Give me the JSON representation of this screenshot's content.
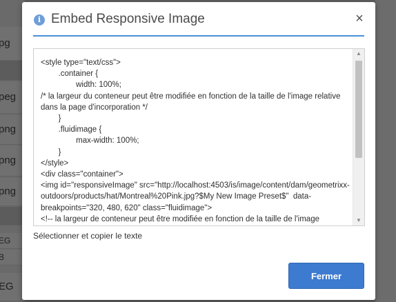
{
  "background": {
    "rows": [
      {
        "label": "pg",
        "style": "normal"
      },
      {
        "label": "",
        "style": "dark"
      },
      {
        "label": "peg",
        "style": "normal"
      },
      {
        "label": "png",
        "style": "normal"
      },
      {
        "label": "png",
        "style": "normal"
      },
      {
        "label": "png",
        "style": "normal"
      },
      {
        "label": "",
        "style": "dark"
      },
      {
        "label": "EG",
        "style": "small"
      },
      {
        "label": "B",
        "style": "small"
      },
      {
        "label": "EG",
        "style": "normal"
      }
    ]
  },
  "dialog": {
    "title": "Embed Responsive Image",
    "info_icon": "i",
    "close_icon": "×",
    "code": "<style type=\"text/css\">\n        .container {\n                width: 100%;\n/* la largeur du conteneur peut être modifiée en fonction de la taille de l'image relative dans la page d'incorporation */\n        }\n        .fluidimage {\n                max-width: 100%;\n        }\n</style>\n<div class=\"container\">\n<img id=\"responsiveImage\" src=\"http://localhost:4503/is/image/content/dam/geometrixx-outdoors/products/hat/Montreal%20Pink.jpg?$My New Image Preset$\"  data-breakpoints=\"320, 480, 620\" class=\"fluidimage\">\n<!-- la largeur de conteneur peut être modifiée en fonction de la taille de l'image",
    "scroll_up_icon": "▲",
    "scroll_down_icon": "▼",
    "helper_text": "Sélectionner et copier le texte",
    "close_button_label": "Fermer"
  },
  "colors": {
    "accent": "#3d7bd0",
    "header_rule": "#4a8fd8",
    "info_icon": "#6e9ed8",
    "overlay": "#5f5f5f"
  }
}
